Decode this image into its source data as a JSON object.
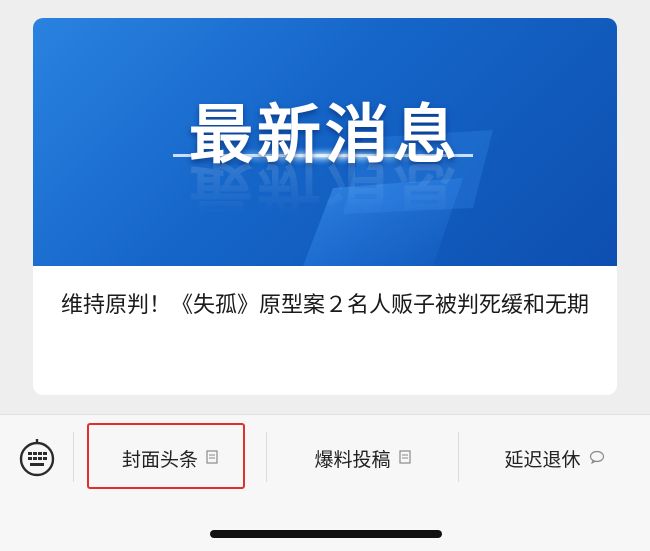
{
  "article": {
    "banner_text": "最新消息",
    "headline": "维持原判！《失孤》原型案２名人贩子被判死缓和无期"
  },
  "menu": {
    "items": [
      {
        "label": "封面头条",
        "icon": "page-icon"
      },
      {
        "label": "爆料投稿",
        "icon": "page-icon"
      },
      {
        "label": "延迟退休",
        "icon": "chat-bubble-icon"
      }
    ],
    "highlighted_index": 0
  },
  "colors": {
    "banner_blue": "#1565c8",
    "highlight_red": "#e0302a"
  }
}
